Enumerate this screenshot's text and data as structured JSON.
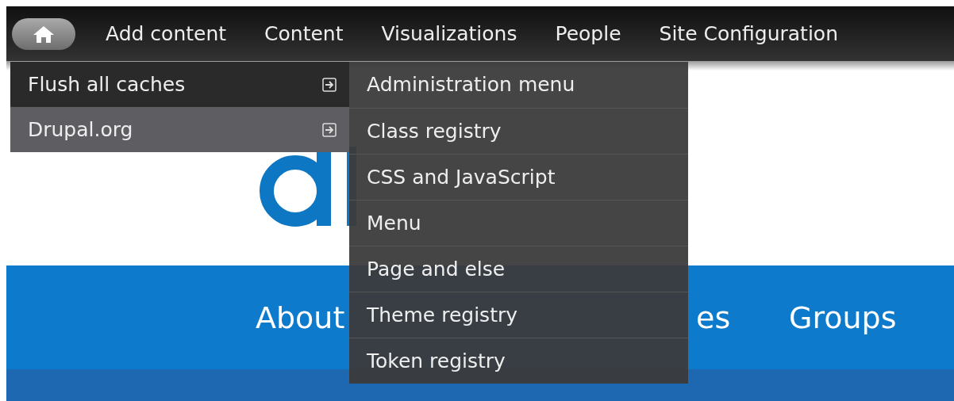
{
  "toolbar": {
    "items": [
      {
        "kind": "home"
      },
      {
        "kind": "link",
        "label": "Add content"
      },
      {
        "kind": "link",
        "label": "Content"
      },
      {
        "kind": "link",
        "label": "Visualizations"
      },
      {
        "kind": "link",
        "label": "People"
      },
      {
        "kind": "link",
        "label": "Site Configuration"
      }
    ]
  },
  "dropdown": {
    "items": [
      {
        "label": "Flush all caches",
        "selected": false
      },
      {
        "label": "Drupal.org",
        "selected": true
      }
    ]
  },
  "submenu": {
    "items": [
      "Administration menu",
      "Class registry",
      "CSS and JavaScript",
      "Menu",
      "Page and else",
      "Theme registry",
      "Token registry"
    ]
  },
  "site_nav": {
    "items": [
      {
        "label": "About"
      },
      {
        "label": "es"
      },
      {
        "label": "Groups"
      }
    ]
  }
}
